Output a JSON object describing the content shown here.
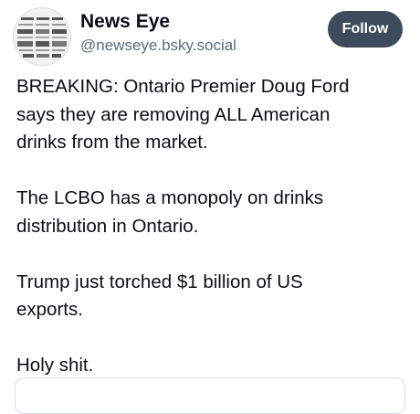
{
  "author": {
    "display_name": "News Eye",
    "handle": "@newseye.bsky.social",
    "avatar_icon": "newspaper-collage-avatar"
  },
  "follow_label": "Follow",
  "post": {
    "paragraphs": [
      {
        "lines": [
          "BREAKING: Ontario Premier Doug Ford",
          "says they are removing ALL American",
          "drinks from the market."
        ]
      },
      {
        "lines": [
          "The LCBO has a monopoly on drinks",
          "distribution in Ontario."
        ]
      },
      {
        "lines": [
          "Trump just torched $1 billion of US",
          "exports."
        ]
      },
      {
        "lines": [
          "Holy shit."
        ]
      }
    ]
  },
  "colors": {
    "button_bg": "#3d4b5c",
    "handle_text": "#5c6b7a",
    "body_text": "#0b0f14"
  }
}
